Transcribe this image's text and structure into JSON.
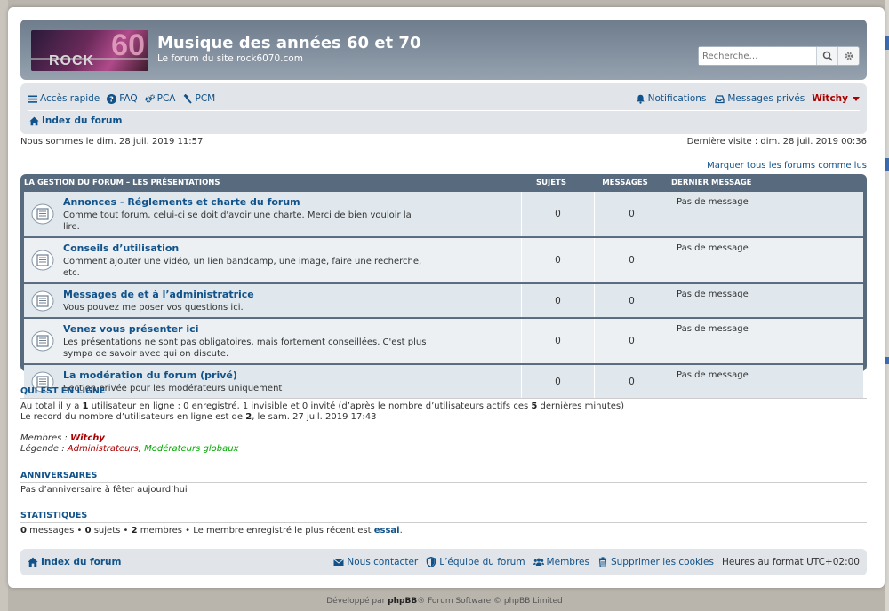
{
  "header": {
    "logo_text": "ROCK",
    "logo_number": "60",
    "site_title": "Musique des années 60 et 70",
    "site_description": "Le forum du site rock6070.com",
    "search_placeholder": "Recherche…"
  },
  "navbar": {
    "quick_links": "Accès rapide",
    "faq": "FAQ",
    "ucp": "PCA",
    "mcp": "PCM",
    "notifications": "Notifications",
    "private_messages": "Messages privés",
    "username": "Witchy",
    "breadcrumb": "Index du forum"
  },
  "info": {
    "current_time": "Nous sommes le dim. 28 juil. 2019 11:57",
    "last_visit": "Dernière visite : dim. 28 juil. 2019 00:36",
    "mark_all_read": "Marquer tous les forums comme lus"
  },
  "forum_table": {
    "category": "La gestion du forum – les présentations",
    "col_topics": "Sujets",
    "col_posts": "Messages",
    "col_last_post": "Dernier message",
    "forums": [
      {
        "title": "Annonces - Réglements et charte du forum",
        "description": "Comme tout forum, celui-ci se doit d'avoir une charte. Merci de bien vouloir la lire.",
        "topics": "0",
        "posts": "0",
        "last_post": "Pas de message"
      },
      {
        "title": "Conseils d’utilisation",
        "description": "Comment ajouter une vidéo, un lien bandcamp, une image, faire une recherche, etc.",
        "topics": "0",
        "posts": "0",
        "last_post": "Pas de message"
      },
      {
        "title": "Messages de et à l’administratrice",
        "description": "Vous pouvez me poser vos questions ici.",
        "topics": "0",
        "posts": "0",
        "last_post": "Pas de message"
      },
      {
        "title": "Venez vous présenter ici",
        "description": "Les présentations ne sont pas obligatoires, mais fortement conseillées. C'est plus sympa de savoir avec qui on discute.",
        "topics": "0",
        "posts": "0",
        "last_post": "Pas de message"
      },
      {
        "title": "La modération du forum (privé)",
        "description": "Section privée pour les modérateurs uniquement",
        "topics": "0",
        "posts": "0",
        "last_post": "Pas de message"
      }
    ]
  },
  "online": {
    "title": "Qui est en ligne",
    "line1_pre": "Au total il y a ",
    "line1_count": "1",
    "line1_mid": " utilisateur en ligne : 0 enregistré, 1 invisible et 0 invité (d’après le nombre d’utilisateurs actifs ces ",
    "line1_minutes": "5",
    "line1_post": " dernières minutes)",
    "line2_pre": "Le record du nombre d’utilisateurs en ligne est de ",
    "line2_count": "2",
    "line2_post": ", le sam. 27 juil. 2019 17:43",
    "members_label": "Membres : ",
    "members_value": "Witchy",
    "legend_label": "Légende : ",
    "legend_admins": "Administrateurs",
    "legend_sep": ", ",
    "legend_mods": "Modérateurs globaux"
  },
  "birthdays": {
    "title": "Anniversaires",
    "text": "Pas d’anniversaire à fêter aujourd’hui"
  },
  "stats": {
    "title": "Statistiques",
    "posts": "0",
    "posts_label": " messages • ",
    "topics": "0",
    "topics_label": " sujets • ",
    "members": "2",
    "members_label": " membres • Le membre enregistré le plus récent est ",
    "newest": "essai",
    "end": "."
  },
  "footer": {
    "index": "Index du forum",
    "contact": "Nous contacter",
    "team": "L’équipe du forum",
    "members": "Membres",
    "delete_cookies": "Supprimer les cookies",
    "timezone": "Heures au format UTC+02:00",
    "powered_pre": "Développé par ",
    "powered_brand": "phpBB",
    "powered_post": "® Forum Software © phpBB Limited"
  },
  "colors": {
    "link": "#105289",
    "admin": "#aa0000",
    "moderator": "#00aa00",
    "table_header": "#586a7e"
  }
}
